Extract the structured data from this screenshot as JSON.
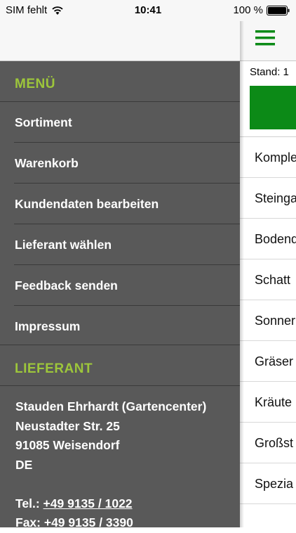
{
  "status_bar": {
    "carrier": "SIM fehlt",
    "time": "10:41",
    "battery": "100 %"
  },
  "drawer": {
    "menu_title": "MENÜ",
    "menu_items": [
      {
        "label": "Sortiment"
      },
      {
        "label": "Warenkorb"
      },
      {
        "label": "Kundendaten bearbeiten"
      },
      {
        "label": "Lieferant wählen"
      },
      {
        "label": "Feedback senden"
      },
      {
        "label": "Impressum"
      }
    ],
    "supplier_title": "LIEFERANT",
    "supplier": {
      "name": "Stauden Ehrhardt (Gartencenter)",
      "street": "Neustadter Str. 25",
      "city": "91085 Weisendorf",
      "country": "DE",
      "tel_label": "Tel.:",
      "tel": "+49 9135 / 1022",
      "fax_label": "Fax:",
      "fax": "+49 9135 / 3390"
    }
  },
  "main": {
    "stand_label": "Stand: 1",
    "categories": [
      {
        "label": "Komple"
      },
      {
        "label": "Steinga"
      },
      {
        "label": "Bodend"
      },
      {
        "label": "Schatt"
      },
      {
        "label": "Sonner"
      },
      {
        "label": "Gräser"
      },
      {
        "label": "Kräute"
      },
      {
        "label": "Großst"
      },
      {
        "label": "Spezia"
      }
    ]
  },
  "colors": {
    "accent_green": "#9dc63b",
    "brand_green": "#0c8a17",
    "drawer_bg": "#595959"
  }
}
